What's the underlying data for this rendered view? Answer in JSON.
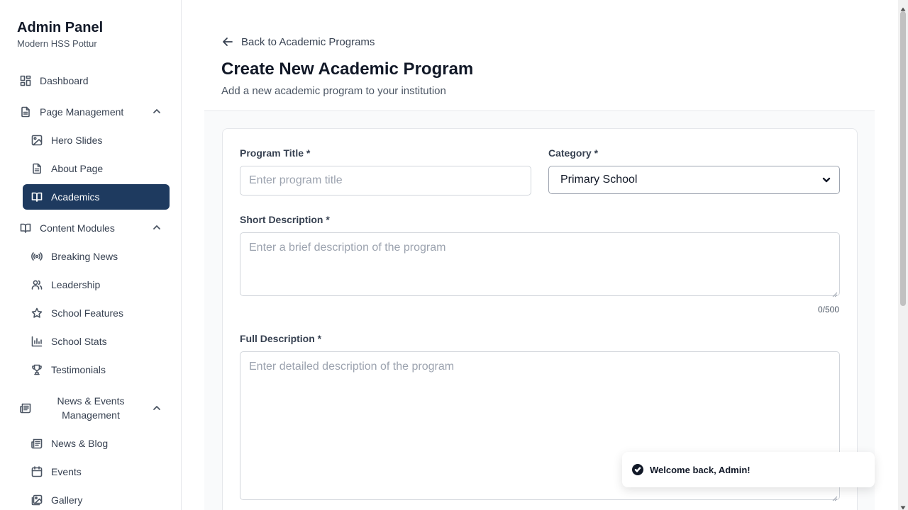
{
  "sidebar": {
    "title": "Admin Panel",
    "subtitle": "Modern HSS Pottur",
    "items": {
      "dashboard": "Dashboard",
      "page_management": "Page Management",
      "hero_slides": "Hero Slides",
      "about_page": "About Page",
      "academics": "Academics",
      "content_modules": "Content Modules",
      "breaking_news": "Breaking News",
      "leadership": "Leadership",
      "school_features": "School Features",
      "school_stats": "School Stats",
      "testimonials": "Testimonials",
      "news_events_management": "News & Events Management",
      "news_blog": "News & Blog",
      "events": "Events",
      "gallery": "Gallery"
    }
  },
  "header": {
    "back_link": "Back to Academic Programs",
    "title": "Create New Academic Program",
    "subtitle": "Add a new academic program to your institution"
  },
  "form": {
    "program_title": {
      "label": "Program Title *",
      "placeholder": "Enter program title",
      "value": ""
    },
    "category": {
      "label": "Category *",
      "selected": "Primary School"
    },
    "short_description": {
      "label": "Short Description *",
      "placeholder": "Enter a brief description of the program",
      "counter": "0/500"
    },
    "full_description": {
      "label": "Full Description *",
      "placeholder": "Enter detailed description of the program"
    }
  },
  "toast": {
    "message": "Welcome back, Admin!"
  },
  "colors": {
    "active_nav_bg": "#1e3a5f",
    "content_bg": "#f9fafb",
    "border": "#e5e7eb"
  }
}
